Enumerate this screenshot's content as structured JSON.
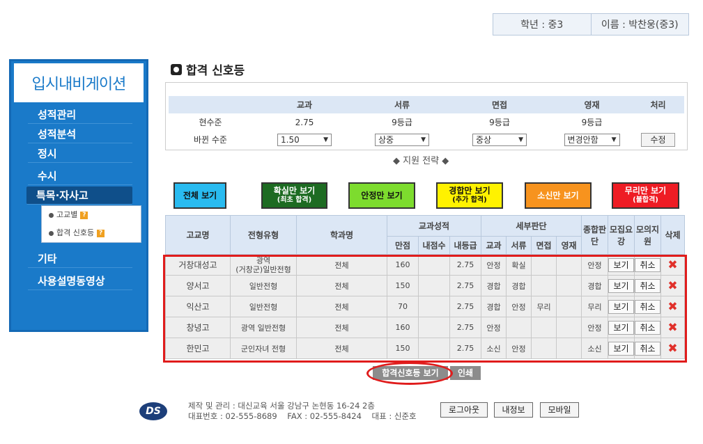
{
  "user": {
    "grade": "학년 : 중3",
    "name": "이름 : 박찬웅(중3)"
  },
  "sidebar": {
    "logo": "입시내비게이션",
    "items": [
      {
        "label": "성적관리"
      },
      {
        "label": "성적분석"
      },
      {
        "label": "정시"
      },
      {
        "label": "수시"
      },
      {
        "label": "특목·자사고"
      },
      {
        "label": "기타"
      },
      {
        "label": "사용설명동영상"
      }
    ],
    "submenu": [
      {
        "label": "고교별"
      },
      {
        "label": "합격 신호등"
      }
    ]
  },
  "page_title": "합격 신호등",
  "standard": {
    "headers": [
      "교과",
      "서류",
      "면접",
      "영재",
      "처리"
    ],
    "current_label": "현수준",
    "current": [
      "2.75",
      "9등급",
      "9등급",
      "9등급"
    ],
    "changed_label": "바뀐 수준",
    "changed": [
      "1.50",
      "상중",
      "중상",
      "변경안함"
    ],
    "modify": "수정"
  },
  "strategy_label": "◆ 지원 전략 ◆",
  "filters": [
    {
      "label": "전체 보기",
      "sub": "",
      "color": "#29bbf0"
    },
    {
      "label": "확실만 보기",
      "sub": "(최초 합격)",
      "color": "#1d6b22",
      "text": "#ffffff"
    },
    {
      "label": "안정만 보기",
      "sub": "",
      "color": "#7ddc2e"
    },
    {
      "label": "경합만 보기",
      "sub": "(추가 합격)",
      "color": "#fff200"
    },
    {
      "label": "소신만 보기",
      "sub": "",
      "color": "#f7931e",
      "text": "#ffffff"
    },
    {
      "label": "무리만 보기",
      "sub": "(불합격)",
      "color": "#ee1c24",
      "text": "#ffffff"
    }
  ],
  "table": {
    "headers": {
      "school": "고교명",
      "type": "전형유형",
      "dept": "학과명",
      "grade_group": "교과성적",
      "full": "만점",
      "internal": "내점수",
      "internal_grade": "내등급",
      "detail_group": "세부판단",
      "d_subject": "교과",
      "d_docs": "서류",
      "d_interview": "면접",
      "d_gifted": "영재",
      "overall": "종합판단",
      "guide": "모집요강",
      "mock": "모의지원",
      "delete": "삭제"
    },
    "rows": [
      {
        "school": "거창대성고",
        "type_top": "광역",
        "type": "(거창군)일반전형",
        "dept": "전체",
        "full": "160",
        "internal": "",
        "grade": "2.75",
        "subj": "안정",
        "docs": "확실",
        "interview": "",
        "gifted": "",
        "overall": "안정",
        "guide": "보기",
        "mock": "취소"
      },
      {
        "school": "양서고",
        "type_top": "",
        "type": "일반전형",
        "dept": "전체",
        "full": "150",
        "internal": "",
        "grade": "2.75",
        "subj": "경합",
        "docs": "경합",
        "interview": "",
        "gifted": "",
        "overall": "경합",
        "guide": "보기",
        "mock": "취소"
      },
      {
        "school": "익산고",
        "type_top": "",
        "type": "일반전형",
        "dept": "전체",
        "full": "70",
        "internal": "",
        "grade": "2.75",
        "subj": "경합",
        "docs": "안정",
        "interview": "무리",
        "gifted": "",
        "overall": "무리",
        "guide": "보기",
        "mock": "취소"
      },
      {
        "school": "창녕고",
        "type_top": "",
        "type": "광역 일반전형",
        "dept": "전체",
        "full": "160",
        "internal": "",
        "grade": "2.75",
        "subj": "안정",
        "docs": "",
        "interview": "",
        "gifted": "",
        "overall": "안정",
        "guide": "보기",
        "mock": "취소"
      },
      {
        "school": "한민고",
        "type_top": "",
        "type": "군인자녀 전형",
        "dept": "전체",
        "full": "150",
        "internal": "",
        "grade": "2.75",
        "subj": "소신",
        "docs": "안정",
        "interview": "",
        "gifted": "",
        "overall": "소신",
        "guide": "보기",
        "mock": "취소"
      }
    ]
  },
  "actions": {
    "view": "합격신호등 보기",
    "print": "인쇄"
  },
  "footer": {
    "logo": "DS",
    "line1": "제작 및 관리 : 대신교육 서울 강남구 논현동 16-24 2층",
    "line2": "대표번호 : 02-555-8689    FAX : 02-555-8424    대표 : 신준호",
    "logout": "로그아웃",
    "myinfo": "내정보",
    "mobile": "모바일"
  }
}
